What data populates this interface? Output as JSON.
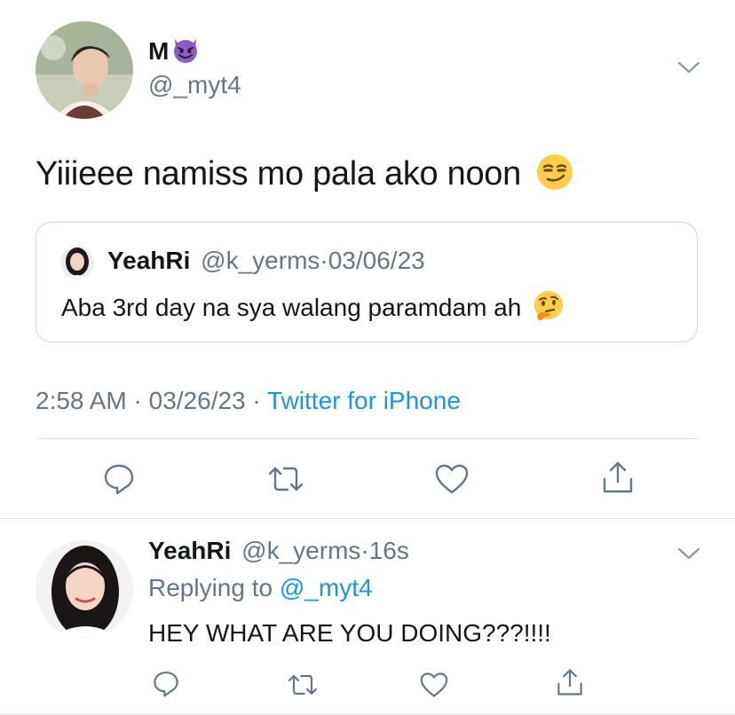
{
  "main_tweet": {
    "author_name": "M",
    "author_emoji": "smiling-imp-emoji",
    "author_handle": "@_myt4",
    "text": "Yiiieee namiss mo pala ako noon",
    "text_emoji": "smirking-face-emoji",
    "quoted": {
      "author_name": "YeahRi",
      "author_handle": "@k_yerms",
      "separator": "·",
      "date": "03/06/23",
      "text": "Aba 3rd day na sya walang paramdam ah",
      "text_emoji": "thinking-face-emoji"
    },
    "meta": {
      "time": "2:58 AM",
      "sep1": "·",
      "date": "03/26/23",
      "sep2": "·",
      "source": "Twitter for iPhone"
    }
  },
  "reply": {
    "author_name": "YeahRi",
    "author_handle": "@k_yerms",
    "separator": "·",
    "age": "16s",
    "replying_prefix": "Replying to",
    "replying_handle": "@_myt4",
    "text": "HEY WHAT ARE YOU DOING???!!!!"
  },
  "colors": {
    "link": "#1b95e0",
    "muted": "#657786",
    "divider": "#e1e8ed",
    "text": "#14171a"
  }
}
